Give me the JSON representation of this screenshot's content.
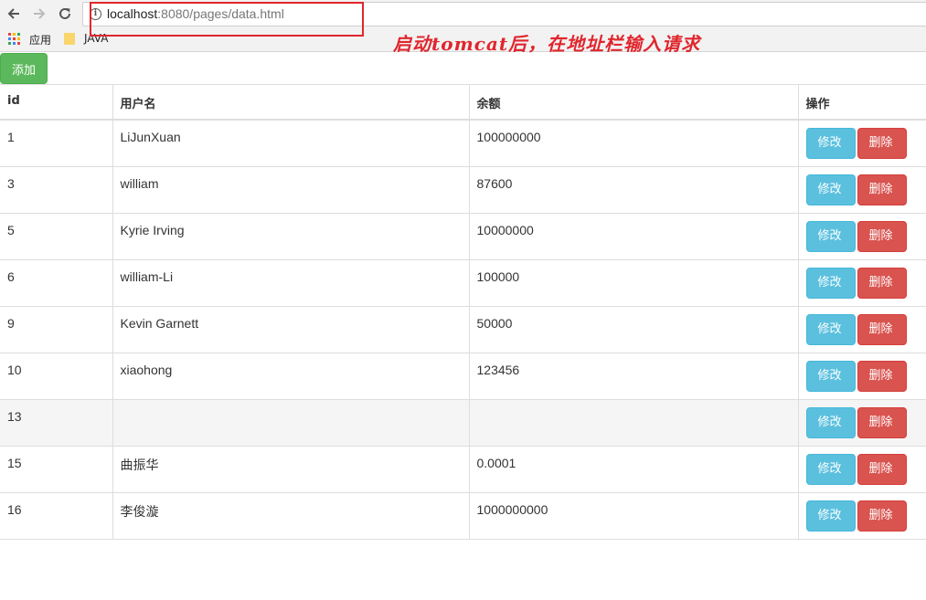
{
  "browser": {
    "url_host": "localhost",
    "url_rest": ":8080/pages/data.html",
    "bookmarks": [
      {
        "label": "应用",
        "icon": "apps-grid-icon"
      },
      {
        "label": "JAVA",
        "icon": "folder-icon"
      }
    ],
    "annotation": "启动tomcat后，在地址栏输入请求",
    "highlight_color": "#e0262d"
  },
  "page": {
    "add_label": "添加",
    "columns": [
      "id",
      "用户名",
      "余额",
      "操作"
    ],
    "edit_label": "修改",
    "delete_label": "删除",
    "rows": [
      {
        "id": "1",
        "username": "LiJunXuan",
        "balance": "100000000"
      },
      {
        "id": "3",
        "username": "william",
        "balance": "87600"
      },
      {
        "id": "5",
        "username": "Kyrie Irving",
        "balance": "10000000"
      },
      {
        "id": "6",
        "username": "william-Li",
        "balance": "100000"
      },
      {
        "id": "9",
        "username": "Kevin Garnett",
        "balance": "50000"
      },
      {
        "id": "10",
        "username": "xiaohong",
        "balance": "123456"
      },
      {
        "id": "13",
        "username": "",
        "balance": ""
      },
      {
        "id": "15",
        "username": "曲振华",
        "balance": "0.0001"
      },
      {
        "id": "16",
        "username": "李俊漩",
        "balance": "1000000000"
      }
    ],
    "colors": {
      "add": "#5cb85c",
      "edit": "#5bc0de",
      "delete": "#d9534f"
    }
  }
}
